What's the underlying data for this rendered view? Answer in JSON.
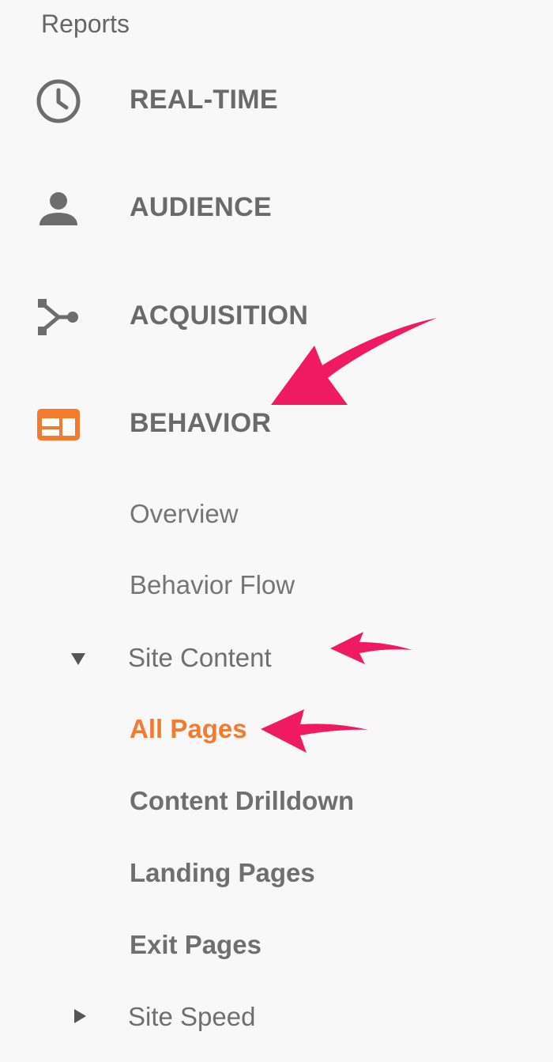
{
  "reports": {
    "title": "Reports",
    "nav": [
      {
        "label": "REAL-TIME",
        "icon": "clock-icon"
      },
      {
        "label": "AUDIENCE",
        "icon": "person-icon"
      },
      {
        "label": "ACQUISITION",
        "icon": "acquisition-icon"
      },
      {
        "label": "BEHAVIOR",
        "icon": "behavior-icon"
      }
    ],
    "behavior_sub": {
      "overview": "Overview",
      "behavior_flow": "Behavior Flow",
      "site_content": "Site Content",
      "all_pages": "All Pages",
      "content_drilldown": "Content Drilldown",
      "landing_pages": "Landing Pages",
      "exit_pages": "Exit Pages",
      "site_speed": "Site Speed"
    }
  },
  "colors": {
    "accent_orange": "#f47a2e",
    "annotation_arrow": "#f01a63",
    "icon_gray": "#6d6d6d",
    "text_gray": "#757575",
    "background": "#f8f8f8"
  }
}
